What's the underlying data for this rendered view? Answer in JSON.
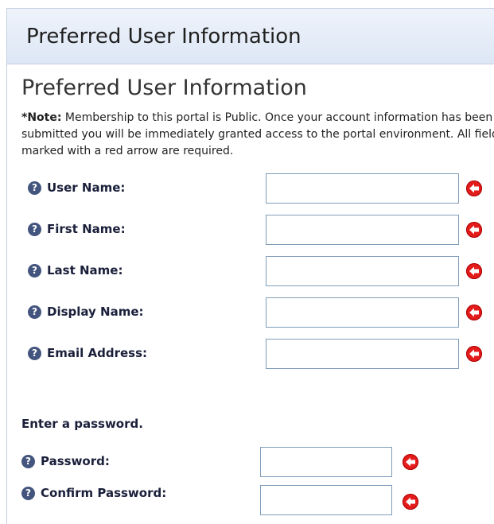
{
  "panel": {
    "title": "Preferred User Information"
  },
  "form": {
    "heading": "Preferred User Information",
    "note_label": "*Note:",
    "note_text": " Membership to this portal is Public. Once your account information has been submitted you will be immediately granted access to the portal environment. All fields marked with a red arrow are required.",
    "fields": [
      {
        "label": "User Name:",
        "value": ""
      },
      {
        "label": "First Name:",
        "value": ""
      },
      {
        "label": "Last Name:",
        "value": ""
      },
      {
        "label": "Display Name:",
        "value": ""
      },
      {
        "label": "Email Address:",
        "value": ""
      }
    ]
  },
  "password": {
    "heading": "Enter a password.",
    "fields": [
      {
        "label": "Password:",
        "value": ""
      },
      {
        "label": "Confirm Password:",
        "value": ""
      }
    ]
  },
  "icons": {
    "help": "help-icon",
    "required": "required-arrow-icon"
  },
  "colors": {
    "required": "#e31b1b",
    "help": "#43557e",
    "titlebar": "#dde7f5"
  }
}
